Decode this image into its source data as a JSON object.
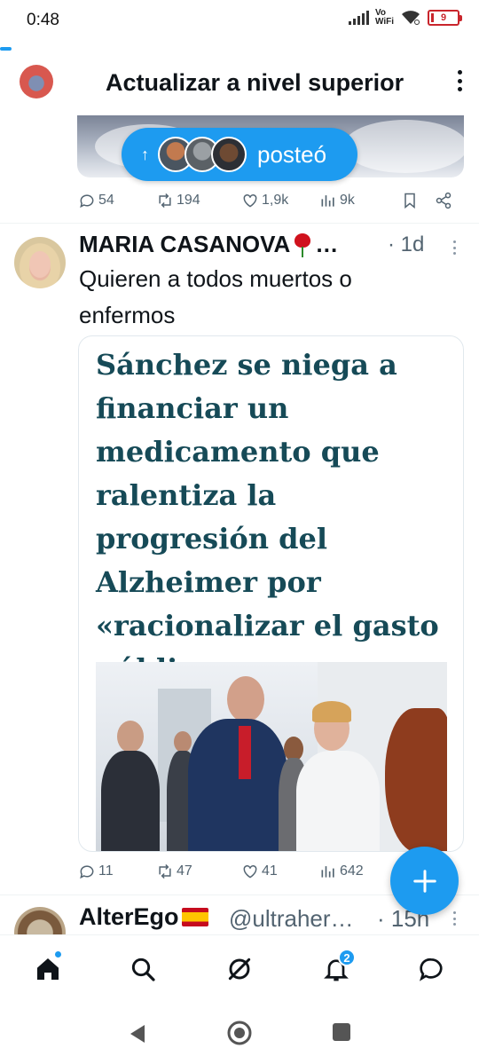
{
  "status_bar": {
    "time": "0:48",
    "network_label_top": "Vo",
    "network_label_bottom": "WiFi",
    "battery_level": "9"
  },
  "header": {
    "title": "Actualizar a nivel superior"
  },
  "posted_pill": {
    "label": "posteó"
  },
  "tweet1": {
    "replies": "54",
    "retweets": "194",
    "likes": "1,9k",
    "views": "9k"
  },
  "tweet2": {
    "name": "MARIA CASANOVA",
    "name_suffix": "…",
    "time": "· 1d",
    "text": "Quieren a todos muertos o enfermos",
    "headline": "Sánchez se niega a financiar un medicamento que ralentiza la progresión del Alzheimer por «racionalizar el gasto público»",
    "replies": "11",
    "retweets": "47",
    "likes": "41",
    "views": "642"
  },
  "tweet3": {
    "name": "AlterEgo",
    "handle": "@ultraher…",
    "time": "· 15h"
  },
  "bottom_nav": {
    "notifications_badge": "2",
    "items": [
      "home-icon",
      "search-icon",
      "grok-icon",
      "bell-icon",
      "messages-icon"
    ]
  },
  "colors": {
    "accent": "#1d9bf0",
    "headline": "#164a57",
    "secondary_text": "#536471"
  }
}
